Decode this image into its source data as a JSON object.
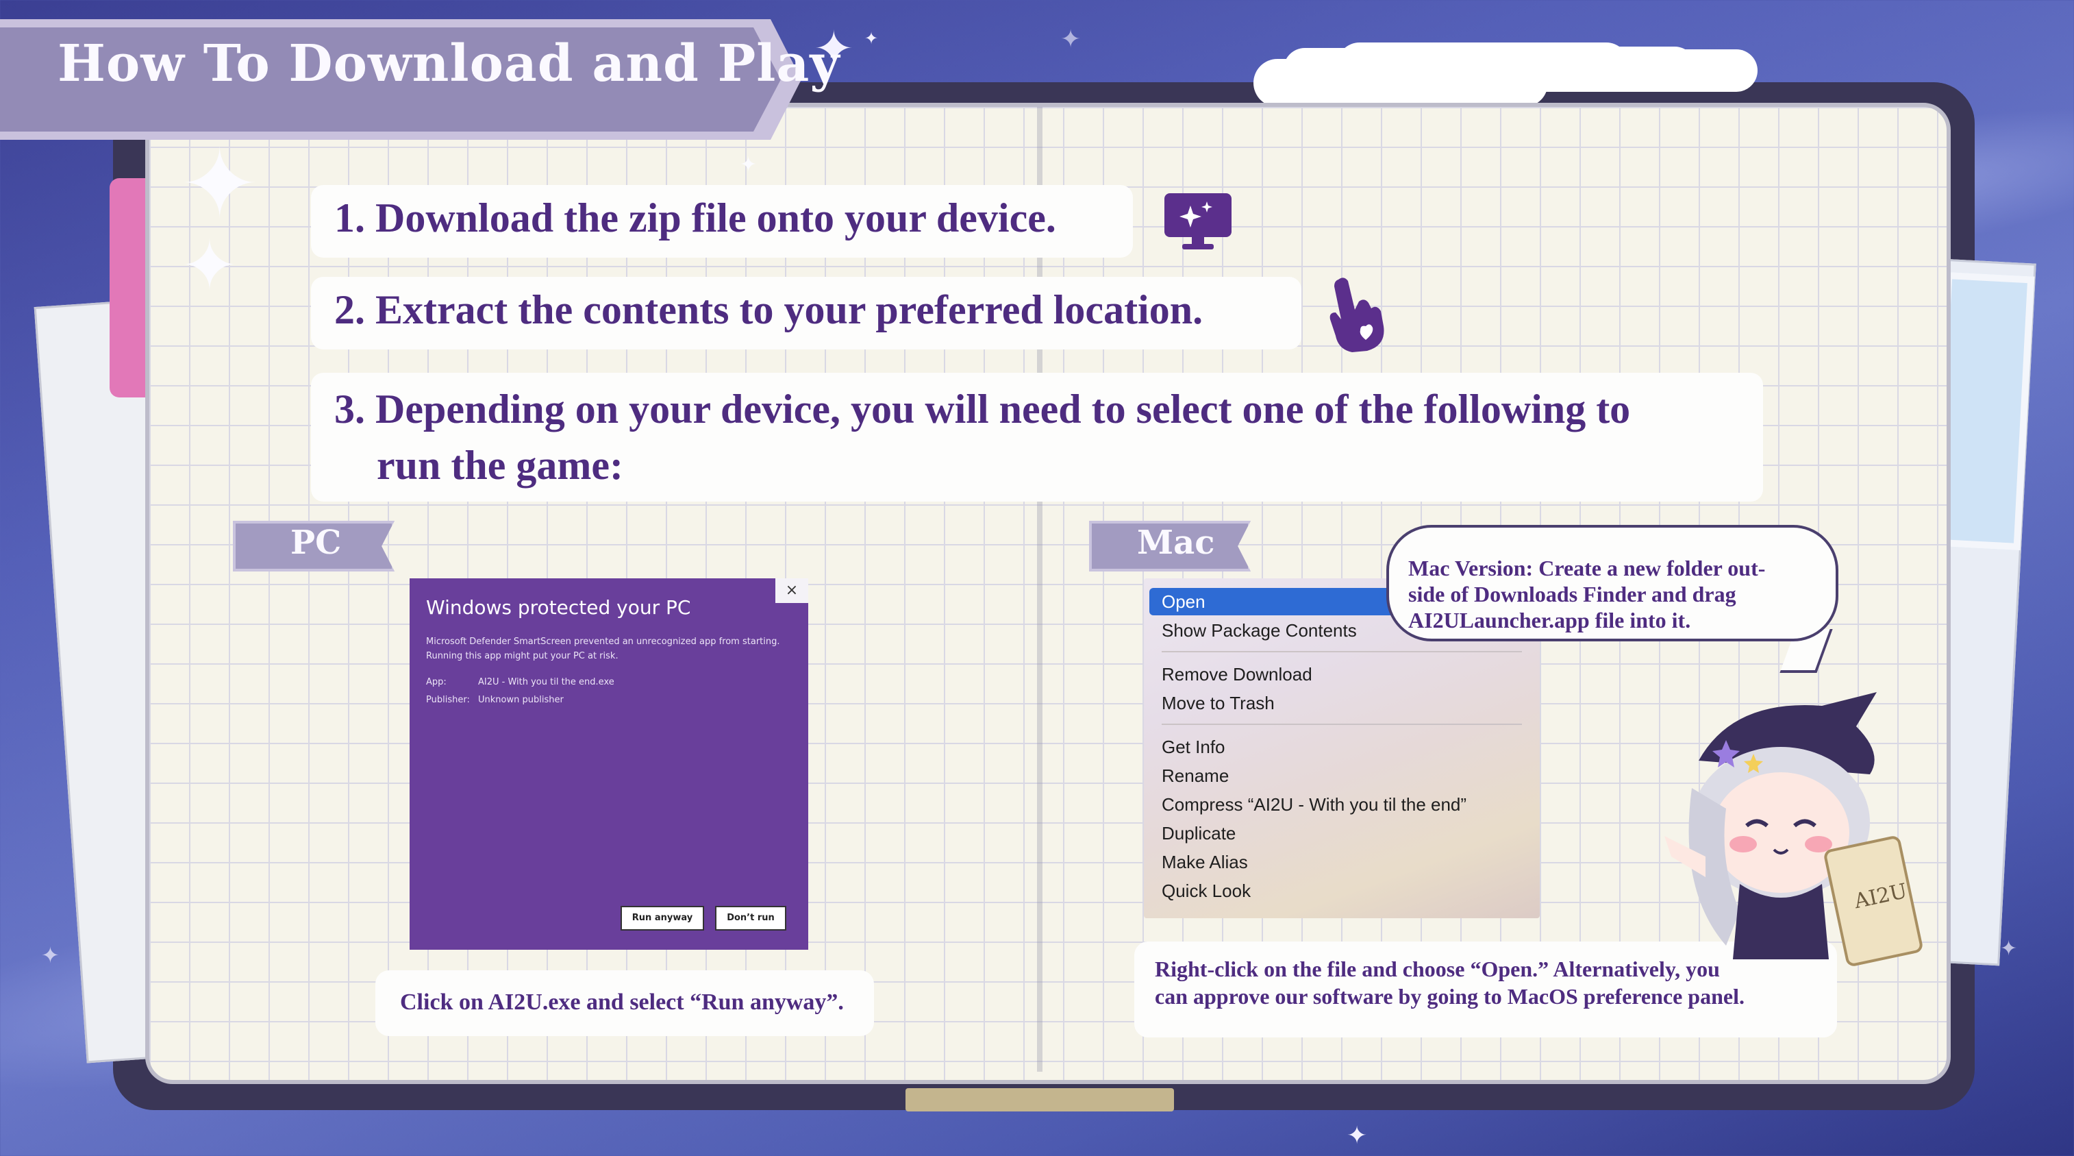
{
  "header": {
    "title": "How To Download and Play"
  },
  "steps": [
    {
      "text": "1. Download the zip file onto your device."
    },
    {
      "text": "2. Extract the contents to your preferred location."
    },
    {
      "line1": "3. Depending on your device, you will need to select one of the following to",
      "line2": "run the game:"
    }
  ],
  "icons": {
    "monitor": "monitor-sparkle-icon",
    "hand": "pointing-hand-heart-icon"
  },
  "pc": {
    "label": "PC",
    "dialog": {
      "title": "Windows protected your PC",
      "close": "×",
      "description": "Microsoft Defender SmartScreen prevented an unrecognized app from starting. Running this app might put your PC at risk.",
      "app_key": "App:",
      "app_value": "AI2U - With you til the end.exe",
      "publisher_key": "Publisher:",
      "publisher_value": "Unknown publisher",
      "run_anyway": "Run anyway",
      "dont_run": "Don’t run"
    },
    "caption": "Click on AI2U.exe and select “Run anyway”."
  },
  "mac": {
    "label": "Mac",
    "menu": {
      "selected": "Open",
      "items": [
        "Open",
        "Show Package Contents",
        "Remove Download",
        "Move to Trash",
        "Get Info",
        "Rename",
        "Compress “AI2U - With you til the end”",
        "Duplicate",
        "Make Alias",
        "Quick Look"
      ]
    },
    "bubble": {
      "line1": "Mac Version: Create a new folder out-",
      "line2": "side of Downloads Finder and drag",
      "line3": "AI2ULauncher.app file into it."
    },
    "caption_line1": "Right-click on the file and choose “Open.” Alternatively, you",
    "caption_line2": "can approve our software by going to MacOS preference panel."
  },
  "mascot": {
    "scroll_text": "AI2U"
  },
  "colors": {
    "accent": "#4e2c80",
    "dialog_bg": "#693f9b",
    "mac_selected": "#2e6bd4",
    "banner": "#938bb6"
  }
}
